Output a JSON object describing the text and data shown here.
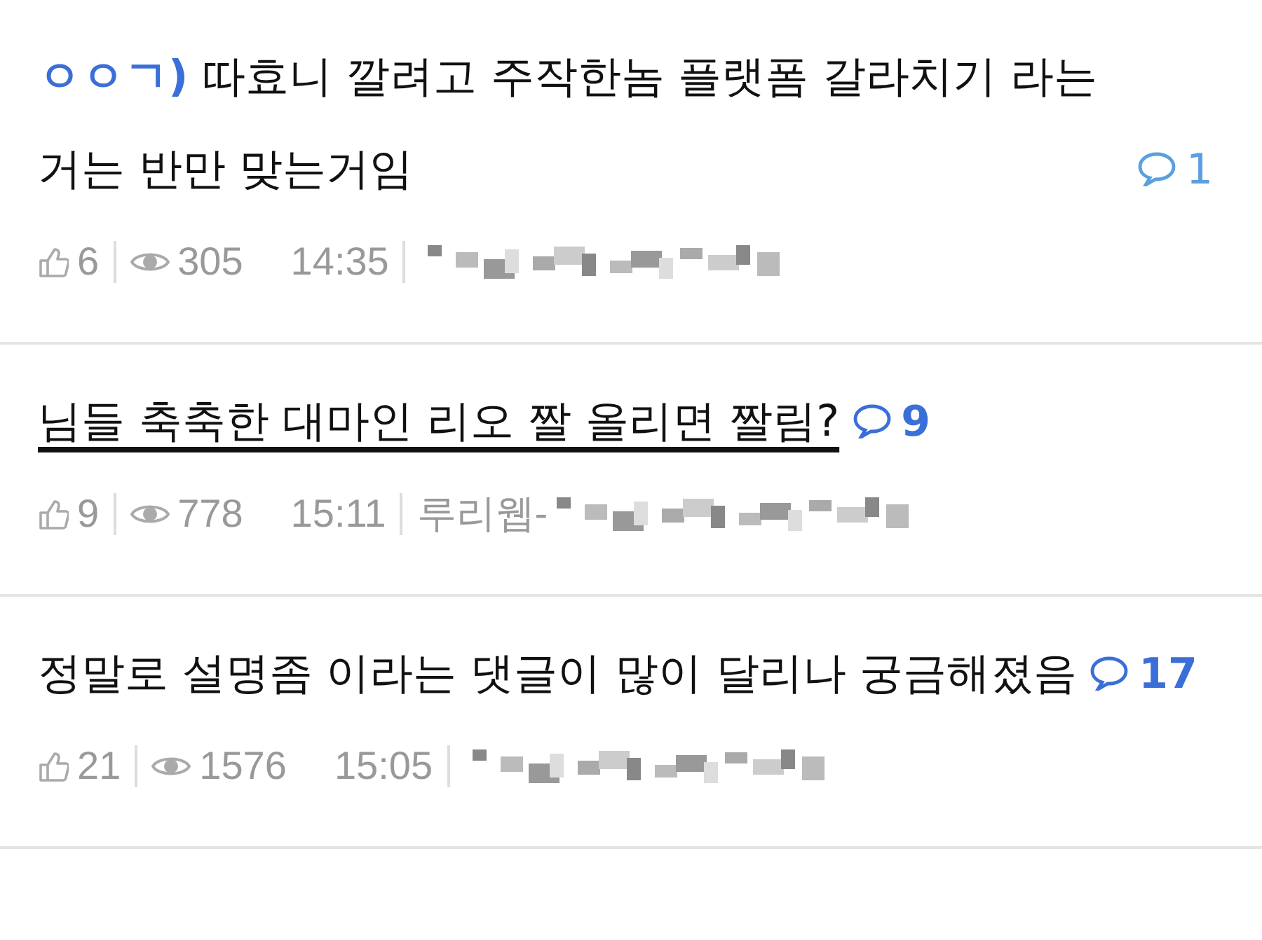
{
  "posts": [
    {
      "prefix": "ㅇㅇㄱ)",
      "title": "따효니 깔려고 주작한놈 플랫폼 갈라치기 라는거는 반만 맞는거임",
      "underlined": false,
      "comment_count": "1",
      "count_bold": false,
      "likes": "6",
      "views": "305",
      "time": "14:35",
      "author_blurred": true
    },
    {
      "title": "님들 축축한 대마인 리오 짤 올리면 짤림?",
      "underlined": true,
      "comment_count": "9",
      "count_bold": true,
      "likes": "9",
      "views": "778",
      "time": "15:11",
      "author": "루리웹-",
      "author_blurred": true
    },
    {
      "title": "정말로 설명좀 이라는 댓글이 많이 달리나 궁금해졌음",
      "underlined": false,
      "comment_count": "17",
      "count_bold": true,
      "likes": "21",
      "views": "1576",
      "time": "15:05",
      "author_blurred": true
    }
  ]
}
